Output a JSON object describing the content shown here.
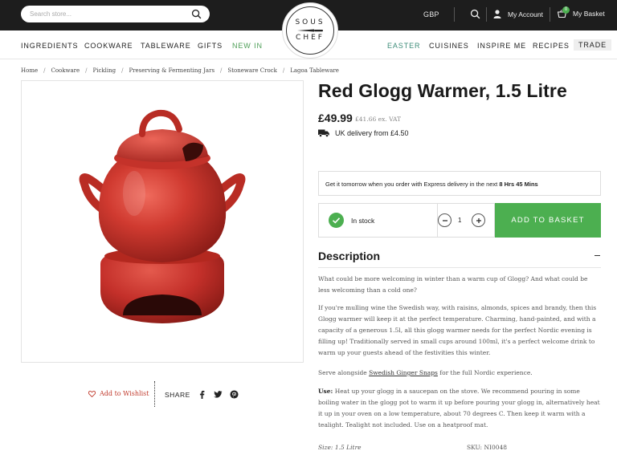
{
  "header": {
    "search_placeholder": "Search store...",
    "currency": "GBP",
    "account_label": "My Account",
    "basket_label": "My Basket",
    "basket_count": "0",
    "logo_line1": "SOUS",
    "logo_line2": "CHEF"
  },
  "nav": {
    "left": [
      "INGREDIENTS",
      "COOKWARE",
      "TABLEWARE",
      "GIFTS",
      "NEW IN"
    ],
    "right": [
      "EASTER",
      "CUISINES",
      "INSPIRE ME",
      "RECIPES"
    ],
    "trade": "TRADE"
  },
  "breadcrumb": [
    "Home",
    "Cookware",
    "Pickling",
    "Preserving & Fermenting Jars",
    "Stoneware Crock",
    "Lagoa Tableware"
  ],
  "product": {
    "title": "Red Glogg Warmer, 1.5 Litre",
    "price": "£49.99",
    "price_ex_vat": "£41.66 ex. VAT",
    "delivery": "UK delivery from £4.50",
    "express_text": "Get it tomorrow when you order with Express delivery in the next",
    "express_time": "8 Hrs 45 Mins",
    "stock": "In stock",
    "quantity": "1",
    "add_to_basket": "ADD TO BASKET",
    "wishlist": "Add to Wishlist",
    "share": "SHARE"
  },
  "description": {
    "heading": "Description",
    "p1": "What could be more welcoming in winter than a warm cup of Glogg? And what could be less welcoming than a cold one?",
    "p2": "If you're mulling wine the Swedish way, with raisins, almonds, spices and brandy, then this Glogg warmer will keep it at the perfect temperature. Charming, hand-painted, and with a capacity of a generous 1.5l, all this glogg warmer needs for the perfect Nordic evening is filling up! Traditionally served in small cups around 100ml, it's a perfect welcome drink to warm up your guests ahead of the festivities this winter.",
    "p3_before": "Serve alongside",
    "p3_link": "Swedish Ginger Snaps",
    "p3_after": "for the full Nordic experience.",
    "use_label": "Use:",
    "use_text": "Heat up your glogg in a saucepan on the stove. We recommend pouring in some boiling water in the glogg pot to warm it up before pouring your glogg in, alternatively heat it up in your oven on a low temperature, about 70 degrees C. Then keep it warm with a tealight. Tealight not included. Use on a heatproof mat.",
    "size_label": "Size:",
    "size_value": "1.5 Litre",
    "sku_label": "SKU:",
    "sku_value": "NI0048"
  },
  "colors": {
    "accent_green": "#4caf50",
    "nav_green": "#4d9e57",
    "pot_red": "#c8302b",
    "topbar": "#1d1d1d"
  }
}
